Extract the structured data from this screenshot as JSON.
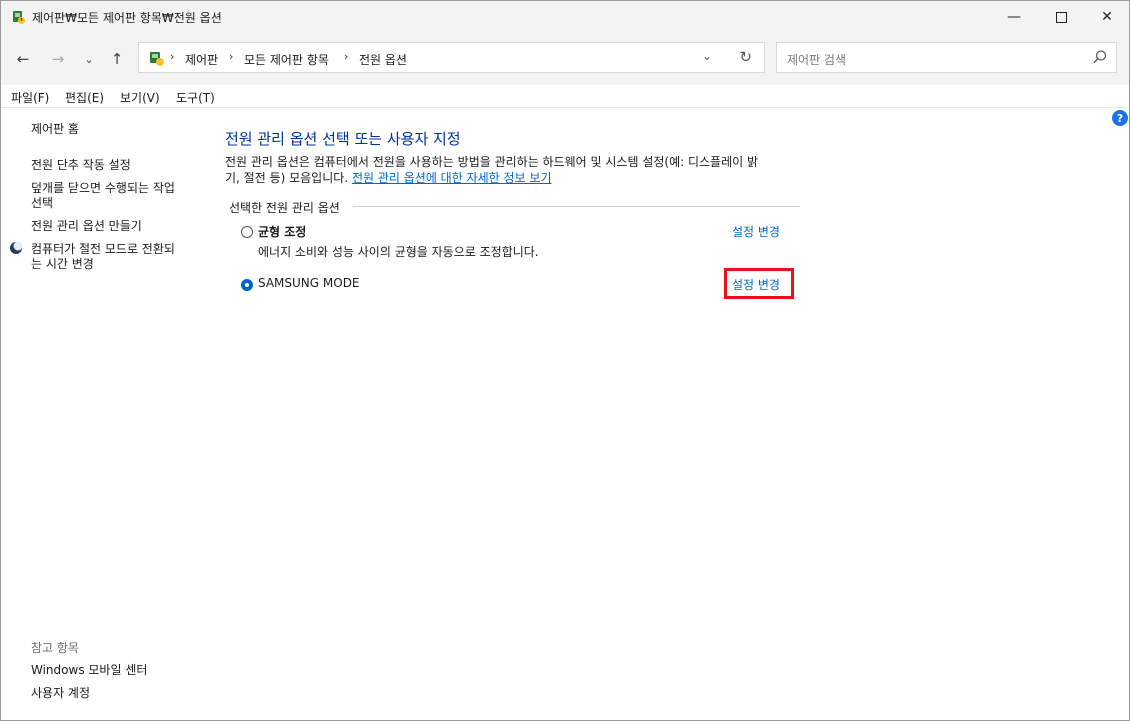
{
  "window": {
    "title": "제어판₩모든 제어판 항목₩전원 옵션",
    "minimize": "—",
    "maximize": "☐",
    "close": "✕"
  },
  "nav": {
    "back": "←",
    "forward": "→",
    "recent": "⌄",
    "up": "↑"
  },
  "address": {
    "crumbs": [
      "제어판",
      "모든 제어판 항목",
      "전원 옵션"
    ],
    "separator": "›",
    "dropdown": "⌄",
    "refresh": "↻"
  },
  "search": {
    "placeholder": "제어판 검색"
  },
  "menu": {
    "items": [
      "파일(F)",
      "편집(E)",
      "보기(V)",
      "도구(T)"
    ]
  },
  "sidebar": {
    "home": "제어판 홈",
    "links": [
      "전원 단추 작동 설정",
      "덮개를 닫으면 수행되는 작업",
      "선택",
      "전원 관리 옵션 만들기",
      "컴퓨터가 절전 모드로 전환되",
      "는 시간 변경"
    ],
    "see_also_title": "참고 항목",
    "see_also": [
      "Windows 모바일 센터",
      "사용자 계정"
    ]
  },
  "main": {
    "title": "전원 관리 옵션 선택 또는 사용자 지정",
    "desc_line1": "전원 관리 옵션은 컴퓨터에서 전원을 사용하는 방법을 관리하는 하드웨어 및 시스템 설정(예: 디스플레이 밝",
    "desc_line2": "기, 절전 등) 모음입니다.",
    "desc_link": "전원 관리 옵션에 대한 자세한 정보 보기",
    "group_label": "선택한 전원 관리 옵션",
    "plans": [
      {
        "name": "균형 조정",
        "desc": "에너지 소비와 성능 사이의 균형을 자동으로 조정합니다.",
        "change": "설정 변경",
        "selected": false
      },
      {
        "name": "SAMSUNG MODE",
        "change": "설정 변경",
        "selected": true
      }
    ]
  },
  "help": "?"
}
